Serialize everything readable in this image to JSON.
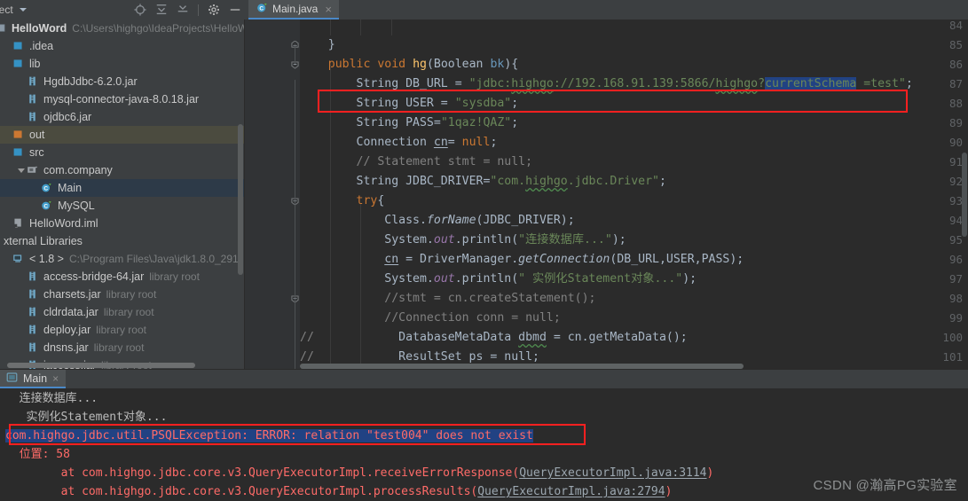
{
  "project_panel": {
    "title": "ject",
    "title_full": "Project",
    "toolbar_icons": [
      "locate-icon",
      "expand-all-icon",
      "collapse-all-icon",
      "settings-gear-icon",
      "minimize-icon"
    ],
    "items": [
      {
        "label": "HelloWord",
        "sub": "C:\\Users\\highgo\\IdeaProjects\\HelloW",
        "icon": "module-icon",
        "indent": 0,
        "bold": true,
        "twisty": "open",
        "state": "normal"
      },
      {
        "label": ".idea",
        "sub": "",
        "icon": "folder-blue-icon",
        "indent": 1,
        "bold": false,
        "twisty": "none",
        "state": "normal"
      },
      {
        "label": "lib",
        "sub": "",
        "icon": "folder-blue-icon",
        "indent": 1,
        "bold": false,
        "twisty": "none",
        "state": "normal"
      },
      {
        "label": "HgdbJdbc-6.2.0.jar",
        "sub": "",
        "icon": "jar-icon",
        "indent": 2,
        "bold": false,
        "twisty": "none",
        "state": "normal"
      },
      {
        "label": "mysql-connector-java-8.0.18.jar",
        "sub": "",
        "icon": "jar-icon",
        "indent": 2,
        "bold": false,
        "twisty": "none",
        "state": "normal"
      },
      {
        "label": "ojdbc6.jar",
        "sub": "",
        "icon": "jar-icon",
        "indent": 2,
        "bold": false,
        "twisty": "none",
        "state": "normal"
      },
      {
        "label": "out",
        "sub": "",
        "icon": "folder-orange-icon",
        "indent": 1,
        "bold": false,
        "twisty": "none",
        "state": "highlight"
      },
      {
        "label": "src",
        "sub": "",
        "icon": "folder-blue-icon",
        "indent": 1,
        "bold": false,
        "twisty": "none",
        "state": "normal"
      },
      {
        "label": "com.company",
        "sub": "",
        "icon": "package-icon",
        "indent": 2,
        "bold": false,
        "twisty": "open",
        "state": "normal"
      },
      {
        "label": "Main",
        "sub": "",
        "icon": "java-class-icon",
        "indent": 3,
        "bold": false,
        "twisty": "none",
        "state": "selected"
      },
      {
        "label": "MySQL",
        "sub": "",
        "icon": "java-class-icon",
        "indent": 3,
        "bold": false,
        "twisty": "none",
        "state": "normal"
      },
      {
        "label": "HelloWord.iml",
        "sub": "",
        "icon": "iml-icon",
        "indent": 1,
        "bold": false,
        "twisty": "none",
        "state": "normal"
      },
      {
        "label": "xternal Libraries",
        "sub": "",
        "icon": "none",
        "indent": 0,
        "bold": false,
        "twisty": "none",
        "state": "normal"
      },
      {
        "label": "< 1.8 >",
        "sub": "C:\\Program Files\\Java\\jdk1.8.0_291",
        "icon": "jdk-icon",
        "indent": 1,
        "bold": false,
        "twisty": "none",
        "state": "normal"
      },
      {
        "label": "access-bridge-64.jar",
        "sub": "library root",
        "icon": "jar-icon",
        "indent": 2,
        "bold": false,
        "twisty": "none",
        "state": "normal"
      },
      {
        "label": "charsets.jar",
        "sub": "library root",
        "icon": "jar-icon",
        "indent": 2,
        "bold": false,
        "twisty": "none",
        "state": "normal"
      },
      {
        "label": "cldrdata.jar",
        "sub": "library root",
        "icon": "jar-icon",
        "indent": 2,
        "bold": false,
        "twisty": "none",
        "state": "normal"
      },
      {
        "label": "deploy.jar",
        "sub": "library root",
        "icon": "jar-icon",
        "indent": 2,
        "bold": false,
        "twisty": "none",
        "state": "normal"
      },
      {
        "label": "dnsns.jar",
        "sub": "library root",
        "icon": "jar-icon",
        "indent": 2,
        "bold": false,
        "twisty": "none",
        "state": "normal"
      },
      {
        "label": "jaccess.jar",
        "sub": "library root",
        "icon": "jar-icon",
        "indent": 2,
        "bold": false,
        "twisty": "none",
        "state": "normal"
      }
    ]
  },
  "editor": {
    "tab": {
      "label": "Main.java",
      "icon": "java-class-icon",
      "close": "×"
    },
    "first_line_number": 84,
    "lines": [
      {
        "n": 84,
        "indent": 0,
        "tokens": [
          {
            "t": "",
            "c": ""
          }
        ]
      },
      {
        "n": 85,
        "indent": 2,
        "tokens": [
          {
            "t": "    }",
            "c": "par"
          }
        ]
      },
      {
        "n": 86,
        "indent": 0,
        "tokens": [
          {
            "t": "    ",
            "c": "par"
          },
          {
            "t": "public",
            "c": "kw"
          },
          {
            "t": " ",
            "c": "par"
          },
          {
            "t": "void",
            "c": "kw"
          },
          {
            "t": " ",
            "c": "par"
          },
          {
            "t": "hg",
            "c": "mth"
          },
          {
            "t": "(",
            "c": "par"
          },
          {
            "t": "Boolean",
            "c": "par"
          },
          {
            "t": " ",
            "c": "par"
          },
          {
            "t": "bk",
            "c": "num"
          },
          {
            "t": "){",
            "c": "par"
          }
        ]
      },
      {
        "n": 87,
        "indent": 0,
        "tokens": [
          {
            "t": "        ",
            "c": "par"
          },
          {
            "t": "String",
            "c": "par"
          },
          {
            "t": " DB_URL = ",
            "c": "par"
          },
          {
            "t": "\"jdbc:",
            "c": "str"
          },
          {
            "t": "highgo",
            "c": "str wavy"
          },
          {
            "t": "://192.168.91.139:5866/",
            "c": "str"
          },
          {
            "t": "highgo",
            "c": "str wavy"
          },
          {
            "t": "?",
            "c": "str"
          },
          {
            "t": "currentSchema",
            "c": "str sel-blue"
          },
          {
            "t": " =test\"",
            "c": "str"
          },
          {
            "t": ";",
            "c": "par"
          }
        ]
      },
      {
        "n": 88,
        "indent": 0,
        "tokens": [
          {
            "t": "        ",
            "c": "par"
          },
          {
            "t": "String",
            "c": "par"
          },
          {
            "t": " USER = ",
            "c": "par"
          },
          {
            "t": "\"sysdba\"",
            "c": "str"
          },
          {
            "t": ";",
            "c": "par"
          }
        ]
      },
      {
        "n": 89,
        "indent": 0,
        "tokens": [
          {
            "t": "        ",
            "c": "par"
          },
          {
            "t": "String",
            "c": "par"
          },
          {
            "t": " PASS=",
            "c": "par"
          },
          {
            "t": "\"1qaz!QAZ\"",
            "c": "str"
          },
          {
            "t": ";",
            "c": "par"
          }
        ]
      },
      {
        "n": 90,
        "indent": 0,
        "tokens": [
          {
            "t": "        ",
            "c": "par"
          },
          {
            "t": "Connection",
            "c": "par"
          },
          {
            "t": " ",
            "c": "par"
          },
          {
            "t": "cn",
            "c": "par uline"
          },
          {
            "t": "= ",
            "c": "par"
          },
          {
            "t": "null",
            "c": "kw"
          },
          {
            "t": ";",
            "c": "par"
          }
        ]
      },
      {
        "n": 91,
        "indent": 0,
        "tokens": [
          {
            "t": "        ",
            "c": "par"
          },
          {
            "t": "// Statement stmt = null;",
            "c": "cmt"
          }
        ]
      },
      {
        "n": 92,
        "indent": 0,
        "tokens": [
          {
            "t": "        ",
            "c": "par"
          },
          {
            "t": "String",
            "c": "par"
          },
          {
            "t": " JDBC_DRIVER=",
            "c": "par"
          },
          {
            "t": "\"com.",
            "c": "str"
          },
          {
            "t": "highgo",
            "c": "str wavy"
          },
          {
            "t": ".jdbc.Driver\"",
            "c": "str"
          },
          {
            "t": ";",
            "c": "par"
          }
        ]
      },
      {
        "n": 93,
        "indent": 0,
        "tokens": [
          {
            "t": "        ",
            "c": "par"
          },
          {
            "t": "try",
            "c": "kw"
          },
          {
            "t": "{",
            "c": "par"
          }
        ]
      },
      {
        "n": 94,
        "indent": 0,
        "tokens": [
          {
            "t": "            ",
            "c": "par"
          },
          {
            "t": "Class",
            "c": "par"
          },
          {
            "t": ".",
            "c": "par"
          },
          {
            "t": "forName",
            "c": "par italic"
          },
          {
            "t": "(JDBC_DRIVER)",
            "c": "par"
          },
          {
            "t": ";",
            "c": "par"
          }
        ]
      },
      {
        "n": 95,
        "indent": 0,
        "tokens": [
          {
            "t": "            ",
            "c": "par"
          },
          {
            "t": "System",
            "c": "par"
          },
          {
            "t": ".",
            "c": "par"
          },
          {
            "t": "out",
            "c": "fld italic"
          },
          {
            "t": ".println(",
            "c": "par"
          },
          {
            "t": "\"连接数据库...\"",
            "c": "str"
          },
          {
            "t": ");",
            "c": "par"
          }
        ]
      },
      {
        "n": 96,
        "indent": 0,
        "tokens": [
          {
            "t": "            ",
            "c": "par"
          },
          {
            "t": "cn",
            "c": "par uline"
          },
          {
            "t": " = DriverManager.",
            "c": "par"
          },
          {
            "t": "getConnection",
            "c": "par italic"
          },
          {
            "t": "(DB_URL,USER,PASS)",
            "c": "par"
          },
          {
            "t": ";",
            "c": "par"
          }
        ]
      },
      {
        "n": 97,
        "indent": 0,
        "tokens": [
          {
            "t": "            ",
            "c": "par"
          },
          {
            "t": "System",
            "c": "par"
          },
          {
            "t": ".",
            "c": "par"
          },
          {
            "t": "out",
            "c": "fld italic"
          },
          {
            "t": ".println(",
            "c": "par"
          },
          {
            "t": "\" 实例化Statement对象...\"",
            "c": "str"
          },
          {
            "t": ");",
            "c": "par"
          }
        ]
      },
      {
        "n": 98,
        "indent": 0,
        "tokens": [
          {
            "t": "            ",
            "c": "par"
          },
          {
            "t": "//stmt = cn.createStatement();",
            "c": "cmt"
          }
        ]
      },
      {
        "n": 99,
        "indent": 0,
        "tokens": [
          {
            "t": "            ",
            "c": "par"
          },
          {
            "t": "//Connection conn = null;",
            "c": "cmt"
          }
        ]
      },
      {
        "n": 100,
        "indent": 0,
        "tokens": [
          {
            "t": "//",
            "c": "cmt"
          },
          {
            "t": "            DatabaseMetaData ",
            "c": "par"
          },
          {
            "t": "dbmd",
            "c": "par wavy"
          },
          {
            "t": " = cn.getMetaData();",
            "c": "par"
          }
        ]
      },
      {
        "n": 101,
        "indent": 0,
        "tokens": [
          {
            "t": "//",
            "c": "cmt"
          },
          {
            "t": "            ResultSet ps = null;",
            "c": "par"
          }
        ]
      }
    ],
    "highlight_box": {
      "label": "red-annotation-box-db-url"
    },
    "fold_markers": [
      86,
      93,
      98
    ],
    "fold_collapse_markers": [
      85
    ]
  },
  "console": {
    "tab": {
      "label": "Main",
      "icon": "console-run-icon",
      "close": "×"
    },
    "lines": [
      {
        "segments": [
          {
            "t": "  连接数据库...",
            "c": "plain"
          }
        ]
      },
      {
        "segments": [
          {
            "t": "   实例化Statement对象...",
            "c": "plain"
          }
        ]
      },
      {
        "segments": [
          {
            "t": "com.highgo.jdbc.util.PSQLException: ERROR: relation \"test004\" does not exist",
            "c": "errsel"
          }
        ]
      },
      {
        "segments": [
          {
            "t": "  位置: 58",
            "c": "err"
          }
        ]
      },
      {
        "segments": [
          {
            "t": "\tat com.highgo.jdbc.core.v3.QueryExecutorImpl.receiveErrorResponse(",
            "c": "err"
          },
          {
            "t": "QueryExecutorImpl.java:3114",
            "c": "link"
          },
          {
            "t": ")",
            "c": "err"
          }
        ]
      },
      {
        "segments": [
          {
            "t": "\tat com.highgo.jdbc.core.v3.QueryExecutorImpl.processResults(",
            "c": "err"
          },
          {
            "t": "QueryExecutorImpl.java:2794",
            "c": "link"
          },
          {
            "t": ")",
            "c": "err"
          }
        ]
      }
    ]
  },
  "watermark": {
    "text": "CSDN @瀚高PG实验室"
  },
  "colors": {
    "panel_bg": "#3c3f41",
    "editor_bg": "#2b2b2b",
    "gutter_bg": "#313335",
    "selection_blue": "#214283",
    "accent_tab": "#4a88c7",
    "annotation_red": "#ff2020",
    "error_red": "#ff6b68",
    "string_green": "#6a8759",
    "keyword_orange": "#cc7832"
  }
}
